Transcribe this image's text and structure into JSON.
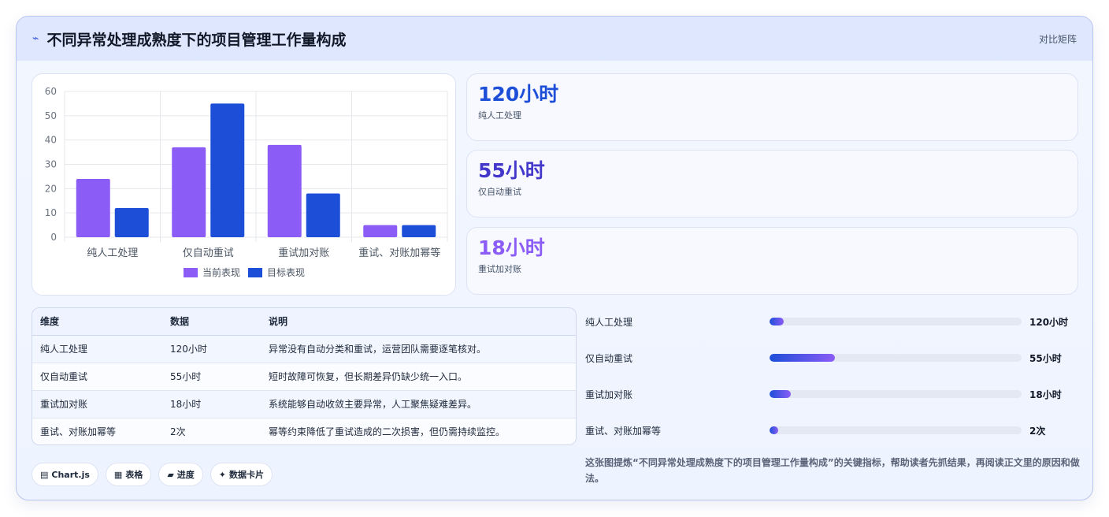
{
  "header": {
    "icon": "trend-icon",
    "title": "不同异常处理成熟度下的项目管理工作量构成",
    "tag": "对比矩阵"
  },
  "chart_data": {
    "type": "bar",
    "categories": [
      "纯人工处理",
      "仅自动重试",
      "重试加对账",
      "重试、对账加幂等"
    ],
    "series": [
      {
        "name": "当前表现",
        "values": [
          24,
          37,
          38,
          5
        ],
        "color": "#8b5cf6"
      },
      {
        "name": "目标表现",
        "values": [
          12,
          55,
          18,
          5
        ],
        "color": "#1d4ed8"
      }
    ],
    "ylim": [
      0,
      60
    ],
    "yticks": [
      0,
      10,
      20,
      30,
      40,
      50,
      60
    ],
    "grid": true,
    "legend": "bottom"
  },
  "stats": [
    {
      "value": "120小时",
      "label": "纯人工处理",
      "color": "#1d4ed8"
    },
    {
      "value": "55小时",
      "label": "仅自动重试",
      "color": "#4338ca"
    },
    {
      "value": "18小时",
      "label": "重试加对账",
      "color": "#8b5cf6"
    }
  ],
  "table": {
    "headers": [
      "维度",
      "数据",
      "说明"
    ],
    "rows": [
      [
        "纯人工处理",
        "120小时",
        "异常没有自动分类和重试，运营团队需要逐笔核对。"
      ],
      [
        "仅自动重试",
        "55小时",
        "短时故障可恢复，但长期差异仍缺少统一入口。"
      ],
      [
        "重试加对账",
        "18小时",
        "系统能够自动收敛主要异常，人工聚焦疑难差异。"
      ],
      [
        "重试、对账加幂等",
        "2次",
        "幂等约束降低了重试造成的二次损害，但仍需持续监控。"
      ]
    ]
  },
  "progress": [
    {
      "label": "纯人工处理",
      "value": "120小时",
      "fraction": 0.055
    },
    {
      "label": "仅自动重试",
      "value": "55小时",
      "fraction": 0.26
    },
    {
      "label": "重试加对账",
      "value": "18小时",
      "fraction": 0.085
    },
    {
      "label": "重试、对账加幂等",
      "value": "2次",
      "fraction": 0.035
    }
  ],
  "chips": [
    {
      "icon": "chart-icon",
      "glyph": "▤",
      "label": "Chart.js"
    },
    {
      "icon": "table-icon",
      "glyph": "▦",
      "label": "表格"
    },
    {
      "icon": "progress-icon",
      "glyph": "▰",
      "label": "进度"
    },
    {
      "icon": "sparkle-icon",
      "glyph": "✦",
      "label": "数据卡片"
    }
  ],
  "caption": "这张图提炼“不同异常处理成熟度下的项目管理工作量构成”的关键指标，帮助读者先抓结果，再阅读正文里的原因和做法。"
}
